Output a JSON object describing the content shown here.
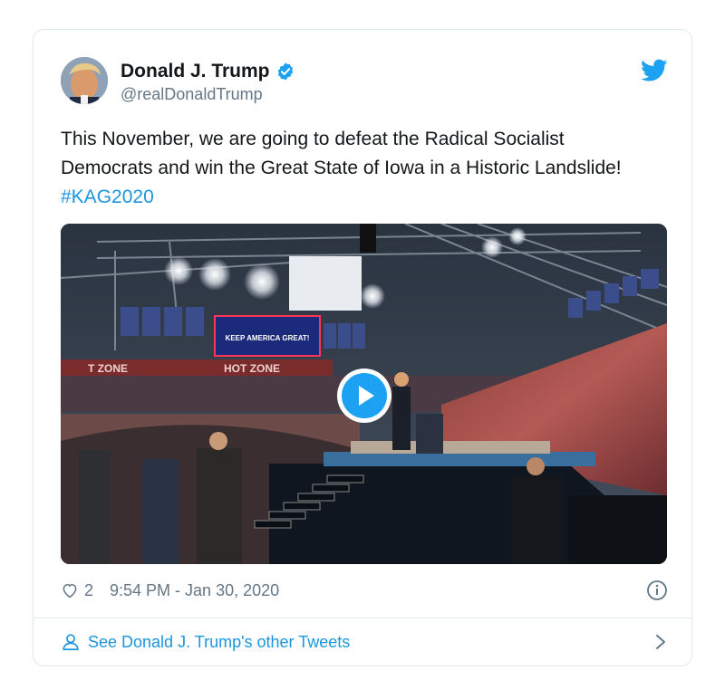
{
  "tweet": {
    "author": {
      "display_name": "Donald J. Trump",
      "handle": "@realDonaldTrump",
      "verified": true
    },
    "text_main": "This November, we are going to defeat the Radical Socialist Democrats and win the Great State of Iowa in a Historic Landslide! ",
    "hashtag": "#KAG2020",
    "media": {
      "banner_text": "KEEP AMERICA GREAT!",
      "sign_left": "T ZONE",
      "sign_right": "HOT ZONE"
    },
    "likes": "2",
    "timestamp": "9:54 PM - Jan 30, 2020"
  },
  "footer": {
    "link_text": "See Donald J. Trump's other Tweets"
  },
  "colors": {
    "brand_blue": "#1da1f2",
    "link_blue": "#1b95e0",
    "secondary_text": "#657786",
    "border": "#e1e8ed"
  }
}
